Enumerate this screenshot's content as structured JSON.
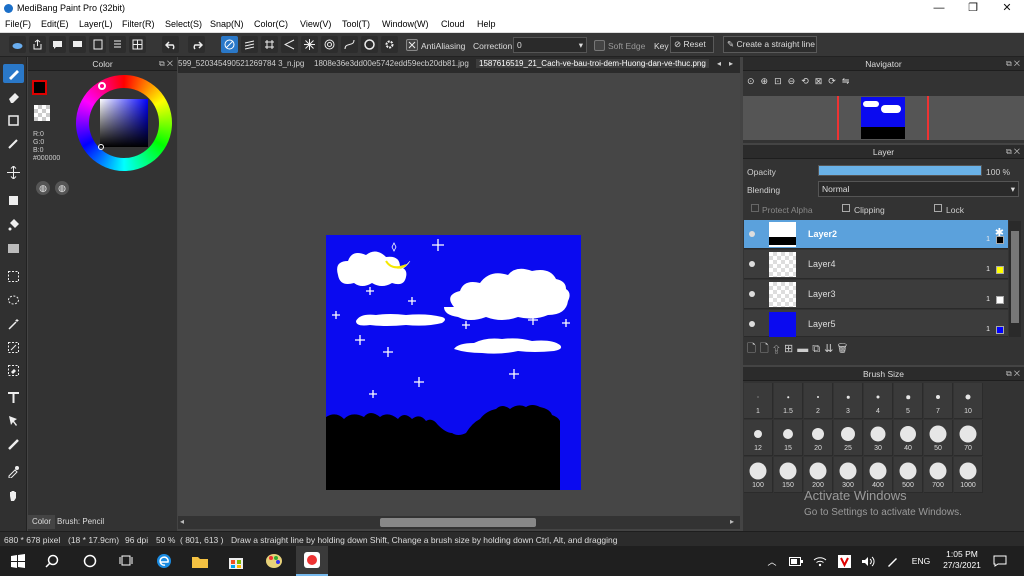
{
  "window": {
    "title": "MediBang Paint Pro (32bit)",
    "min_label": "—",
    "max_label": "❐",
    "close_label": "✕"
  },
  "menu": [
    "File(F)",
    "Edit(E)",
    "Layer(L)",
    "Filter(R)",
    "Select(S)",
    "Snap(N)",
    "Color(C)",
    "View(V)",
    "Tool(T)",
    "Window(W)",
    "Cloud",
    "Help"
  ],
  "toolbar": {
    "antialiasing_label": "AntiAliasing",
    "correction_label": "Correction",
    "correction_value": "0",
    "soft_edge_label": "Soft Edge",
    "key_label": "Key",
    "reset_label": "Reset",
    "straight_line_label": "Create a straight line"
  },
  "color_panel": {
    "title": "Color",
    "r": "R:0",
    "g": "G:0",
    "b": "B:0",
    "hex": "#000000",
    "foreground": "#000000",
    "tab_color": "Color",
    "tab_brush": "Brush: Pencil"
  },
  "tabs": [
    "599_520345490521269784 3_n.jpg",
    "1808e36e3dd00e5742edd59ecb20db81.jpg",
    "1587616519_21_Cach-ve-bau-troi-dem-Huong-dan-ve-thuc.png"
  ],
  "navigator": {
    "title": "Navigator"
  },
  "layer_panel": {
    "title": "Layer",
    "opacity_label": "Opacity",
    "opacity_value": "100 %",
    "opacity_fraction": 1.0,
    "blending_label": "Blending",
    "blending_value": "Normal",
    "protect_alpha_label": "Protect Alpha",
    "clipping_label": "Clipping",
    "lock_label": "Lock",
    "layers": [
      {
        "name": "Layer2",
        "num": "1",
        "color": "#000000"
      },
      {
        "name": "Layer4",
        "num": "1",
        "color": "#ffff00"
      },
      {
        "name": "Layer3",
        "num": "1",
        "color": "#ffffff"
      },
      {
        "name": "Layer5",
        "num": "1",
        "color": "#0000ff"
      }
    ]
  },
  "brush_size": {
    "title": "Brush Size",
    "sizes": [
      "1",
      "1.5",
      "2",
      "3",
      "4",
      "5",
      "7",
      "10",
      "12",
      "15",
      "20",
      "25",
      "30",
      "40",
      "50",
      "70",
      "100",
      "150",
      "200",
      "300",
      "400",
      "500",
      "700",
      "1000"
    ]
  },
  "watermark": {
    "line1": "Activate Windows",
    "line2": "Go to Settings to activate Windows."
  },
  "status": {
    "size": "680 * 678 pixel",
    "cm": "(18 * 17.9cm)",
    "dpi": "96 dpi",
    "zoom": "50 %",
    "coords": "( 801, 613 )",
    "hint": "Draw a straight line by holding down Shift, Change a brush size by holding down Ctrl, Alt, and dragging"
  },
  "taskbar": {
    "language": "ENG",
    "time": "1:05 PM",
    "date": "27/3/2021"
  },
  "colors": {
    "canvas_sky": "#0a0af0",
    "accent": "#2a78c8",
    "selected_layer": "#5ba1dc"
  }
}
